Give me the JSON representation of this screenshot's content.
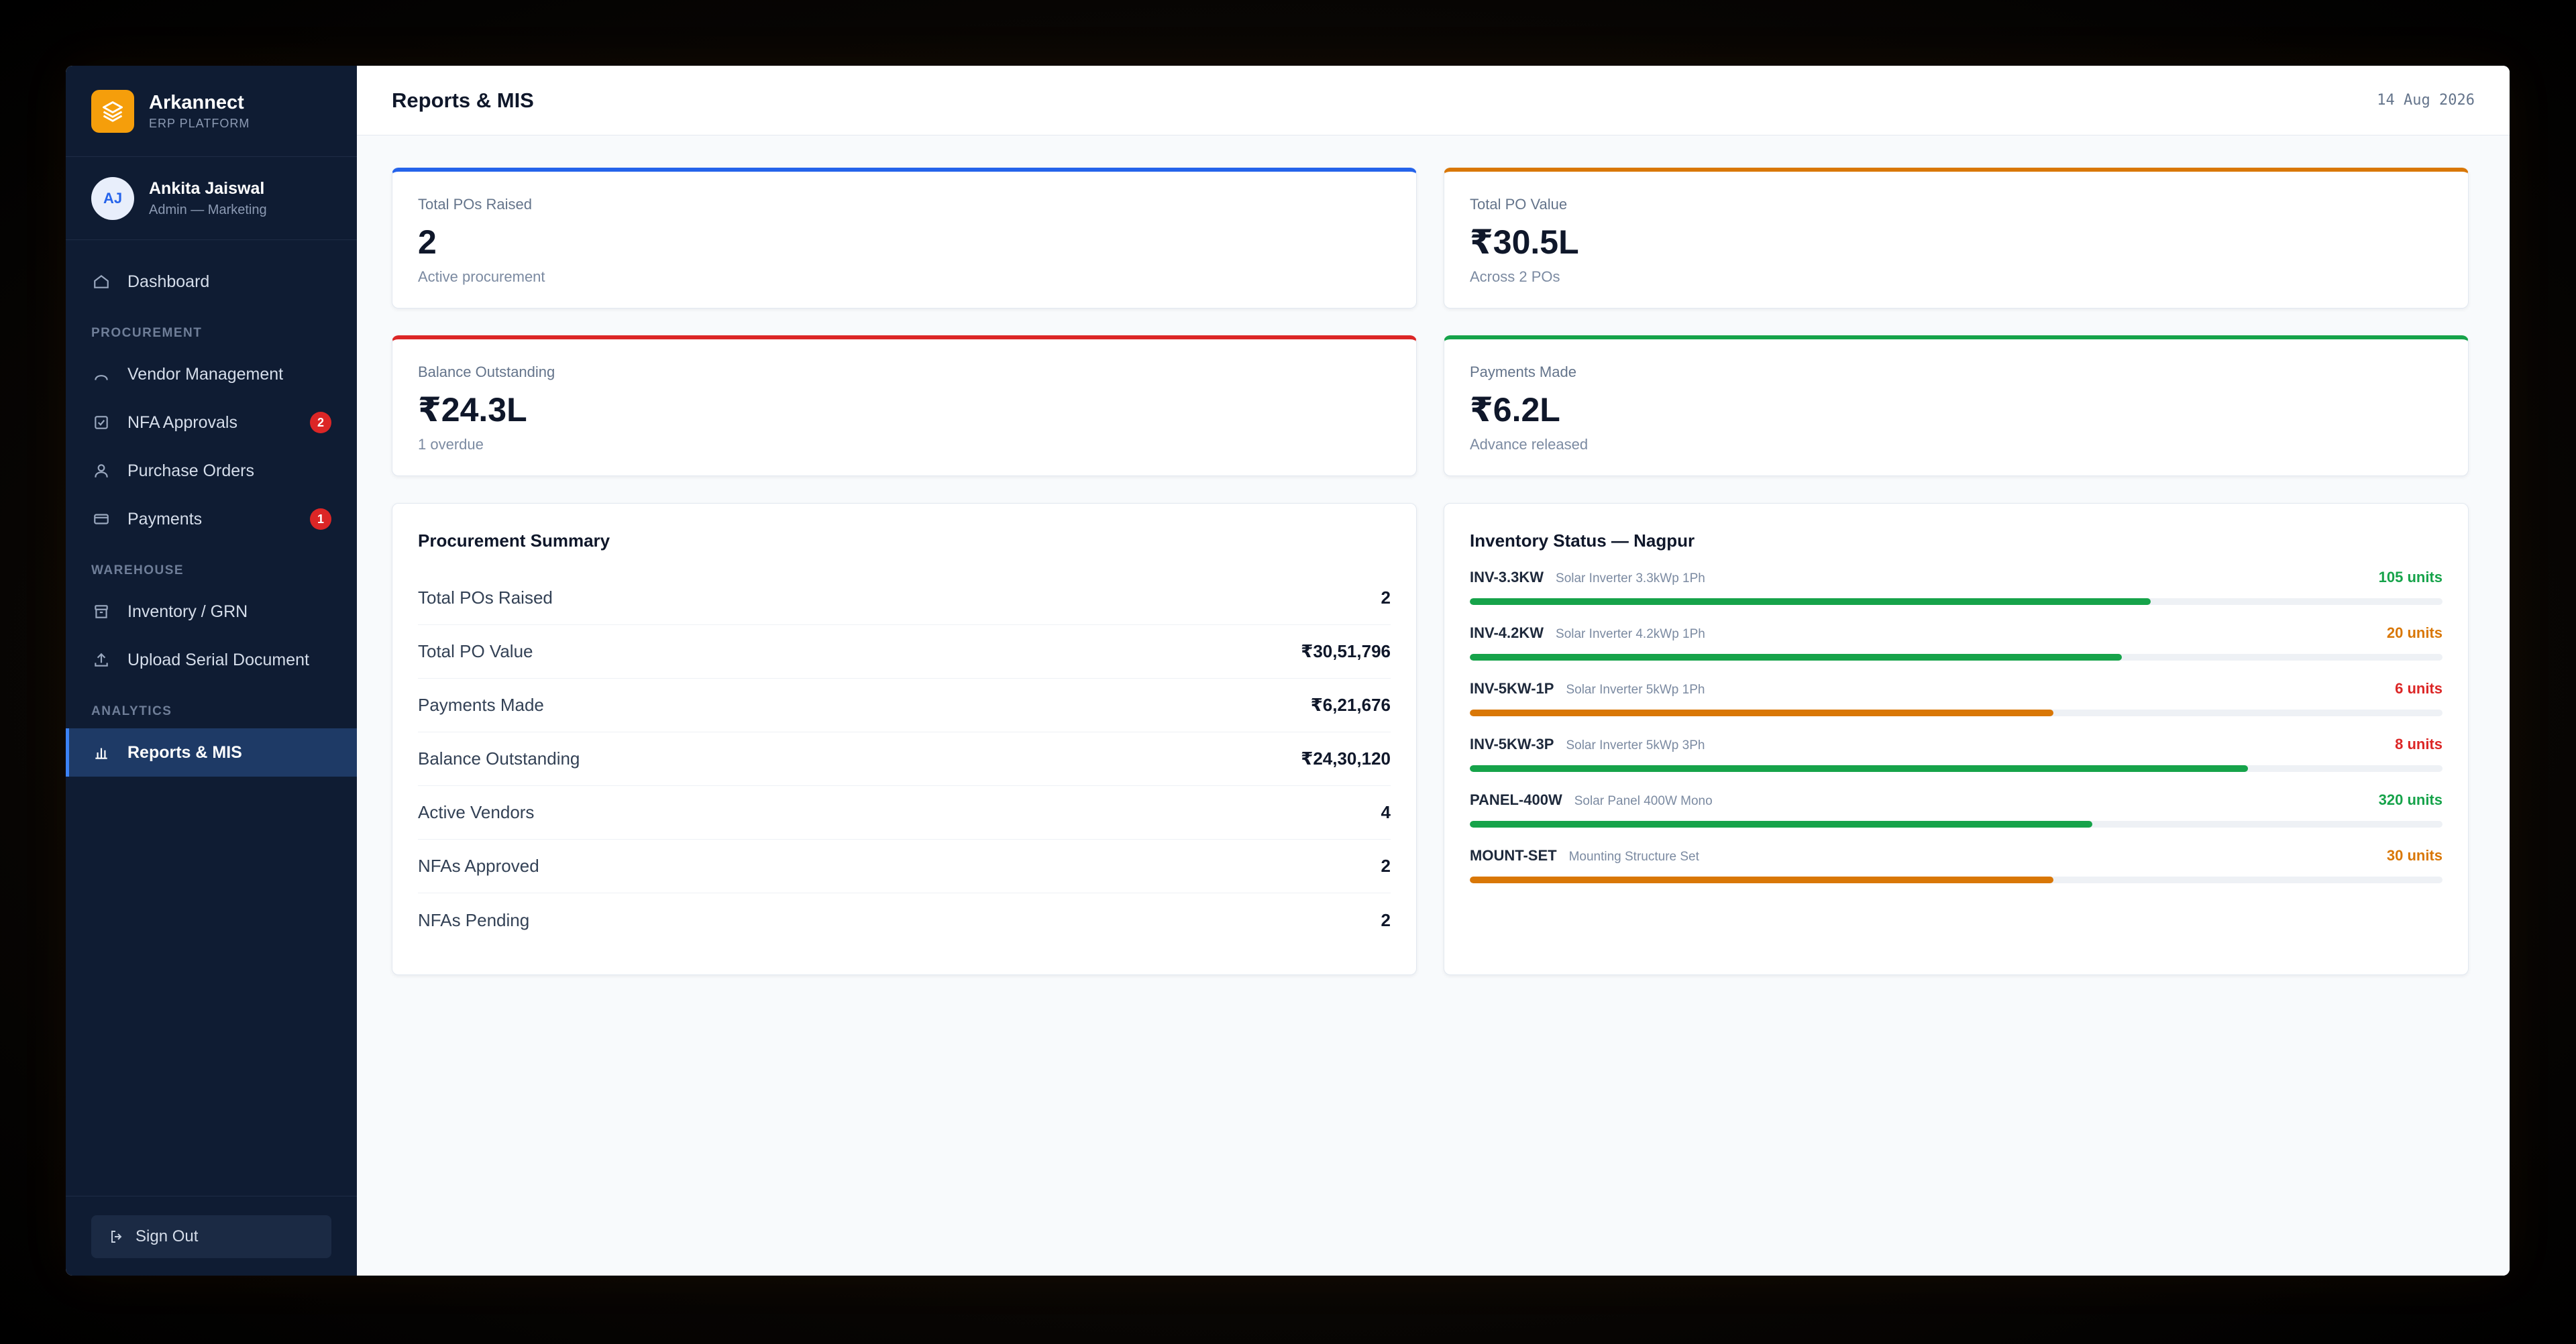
{
  "brand": {
    "name": "Arkannect",
    "subtitle": "ERP PLATFORM"
  },
  "user": {
    "initials": "AJ",
    "name": "Ankita Jaiswal",
    "role": "Admin — Marketing"
  },
  "nav": {
    "dashboard": "Dashboard",
    "sections": {
      "procurement": "PROCUREMENT",
      "warehouse": "WAREHOUSE",
      "analytics": "ANALYTICS"
    },
    "vendor": "Vendor Management",
    "nfa": {
      "label": "NFA Approvals",
      "badge": "2"
    },
    "po": "Purchase Orders",
    "payments": {
      "label": "Payments",
      "badge": "1"
    },
    "inventory": "Inventory / GRN",
    "upload": "Upload Serial Document",
    "reports": "Reports & MIS"
  },
  "signout": "Sign Out",
  "header": {
    "title": "Reports & MIS",
    "date": "14 Aug 2026"
  },
  "kpis": [
    {
      "label": "Total POs Raised",
      "value": "2",
      "sub": "Active procurement",
      "color": "#2563eb"
    },
    {
      "label": "Total PO Value",
      "value": "₹30.5L",
      "sub": "Across 2 POs",
      "color": "#d97706"
    },
    {
      "label": "Balance Outstanding",
      "value": "₹24.3L",
      "sub": "1 overdue",
      "color": "#dc2626"
    },
    {
      "label": "Payments Made",
      "value": "₹6.2L",
      "sub": "Advance released",
      "color": "#16a34a"
    }
  ],
  "summary": {
    "title": "Procurement Summary",
    "rows": [
      {
        "label": "Total POs Raised",
        "value": "2"
      },
      {
        "label": "Total PO Value",
        "value": "₹30,51,796"
      },
      {
        "label": "Payments Made",
        "value": "₹6,21,676"
      },
      {
        "label": "Balance Outstanding",
        "value": "₹24,30,120"
      },
      {
        "label": "Active Vendors",
        "value": "4"
      },
      {
        "label": "NFAs Approved",
        "value": "2"
      },
      {
        "label": "NFAs Pending",
        "value": "2"
      }
    ]
  },
  "inventory": {
    "title": "Inventory Status — Nagpur",
    "items": [
      {
        "code": "INV-3.3KW",
        "desc": "Solar Inverter 3.3kWp 1Ph",
        "qty": "105 units",
        "level": 0.7,
        "bar_color": "#16a34a",
        "qty_color": "#16a34a"
      },
      {
        "code": "INV-4.2KW",
        "desc": "Solar Inverter 4.2kWp 1Ph",
        "qty": "20 units",
        "level": 0.67,
        "bar_color": "#16a34a",
        "qty_color": "#d97706"
      },
      {
        "code": "INV-5KW-1P",
        "desc": "Solar Inverter 5kWp 1Ph",
        "qty": "6 units",
        "level": 0.6,
        "bar_color": "#d97706",
        "qty_color": "#dc2626"
      },
      {
        "code": "INV-5KW-3P",
        "desc": "Solar Inverter 5kWp 3Ph",
        "qty": "8 units",
        "level": 0.8,
        "bar_color": "#16a34a",
        "qty_color": "#dc2626"
      },
      {
        "code": "PANEL-400W",
        "desc": "Solar Panel 400W Mono",
        "qty": "320 units",
        "level": 0.64,
        "bar_color": "#16a34a",
        "qty_color": "#16a34a"
      },
      {
        "code": "MOUNT-SET",
        "desc": "Mounting Structure Set",
        "qty": "30 units",
        "level": 0.6,
        "bar_color": "#d97706",
        "qty_color": "#d97706"
      }
    ]
  }
}
